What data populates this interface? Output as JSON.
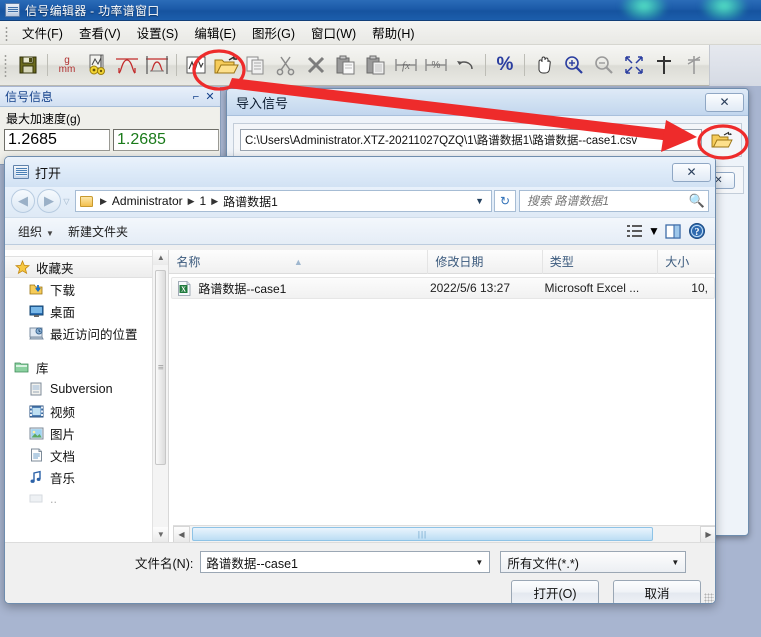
{
  "app": {
    "title": "信号编辑器 - 功率谱窗口",
    "title_icon": "app-icon",
    "menu": [
      {
        "label": "文件(F)"
      },
      {
        "label": "查看(V)"
      },
      {
        "label": "设置(S)"
      },
      {
        "label": "编辑(E)"
      },
      {
        "label": "图形(G)"
      },
      {
        "label": "窗口(W)"
      },
      {
        "label": "帮助(H)"
      }
    ],
    "toolbar": [
      {
        "name": "save-icon",
        "type": "icon"
      },
      {
        "name": "separator",
        "type": "sep"
      },
      {
        "name": "units-g-mm-icon",
        "type": "icon",
        "text_top": "g",
        "text_bottom": "mm"
      },
      {
        "name": "settings-gear-icon",
        "type": "icon"
      },
      {
        "name": "spectrum-curve-icon",
        "type": "icon"
      },
      {
        "name": "spectrum-grid-icon",
        "type": "icon"
      },
      {
        "name": "separator",
        "type": "sep"
      },
      {
        "name": "waveform-icon",
        "type": "icon"
      },
      {
        "name": "open-folder-icon",
        "type": "icon"
      },
      {
        "name": "copy-icon",
        "type": "icon"
      },
      {
        "name": "cut-scissors-icon",
        "type": "icon"
      },
      {
        "name": "delete-x-icon",
        "type": "icon"
      },
      {
        "name": "paste-icon",
        "type": "icon"
      },
      {
        "name": "paste-special-icon",
        "type": "icon"
      },
      {
        "name": "insert-fx-icon",
        "type": "icon"
      },
      {
        "name": "insert-percent-icon",
        "type": "icon"
      },
      {
        "name": "undo-icon",
        "type": "icon"
      },
      {
        "name": "separator",
        "type": "sep"
      },
      {
        "name": "percent-icon",
        "type": "icon"
      },
      {
        "name": "separator",
        "type": "sep"
      },
      {
        "name": "pan-hand-icon",
        "type": "icon"
      },
      {
        "name": "zoom-in-icon",
        "type": "icon"
      },
      {
        "name": "zoom-out-icon",
        "type": "icon"
      },
      {
        "name": "fit-to-window-icon",
        "type": "icon"
      },
      {
        "name": "crosshair-icon",
        "type": "icon"
      },
      {
        "name": "marker-icon",
        "type": "icon"
      }
    ]
  },
  "signal_info": {
    "title": "信号信息",
    "pin_icon": "pin-icon",
    "close_icon": "close-icon",
    "field_label": "最大加速度(g)",
    "value_left": "1.2685",
    "value_right": "1.2685",
    "value_right_color": "#1a7a1a"
  },
  "import_dialog": {
    "title": "导入信号",
    "close_label": "✕",
    "path_value": "C:\\Users\\Administrator.XTZ-20211027QZQ\\1\\路谱数据1\\路谱数据--case1.csv",
    "browse_icon": "open-folder-icon"
  },
  "open_dialog": {
    "title": "打开",
    "title_icon": "app-icon",
    "close_label": "✕",
    "nav": {
      "back_icon": "back-arrow-icon",
      "forward_icon": "forward-arrow-icon",
      "history_icon": "chevron-down-icon",
      "breadcrumb": [
        "Administrator",
        "1",
        "路谱数据1"
      ],
      "breadcrumb_caret": "▼",
      "refresh_icon": "refresh-icon"
    },
    "search": {
      "placeholder": "搜索 路谱数据1",
      "icon": "search-icon"
    },
    "command_bar": {
      "organize": "组织",
      "organize_caret": "▼",
      "new_folder": "新建文件夹",
      "view_icon": "view-list-icon",
      "view_caret": "▼",
      "preview_icon": "preview-pane-icon",
      "help_icon": "help-icon"
    },
    "sidebar": [
      {
        "label": "收藏夹",
        "icon": "star-icon",
        "root": true,
        "selected": true
      },
      {
        "label": "下载",
        "icon": "downloads-icon"
      },
      {
        "label": "桌面",
        "icon": "desktop-icon"
      },
      {
        "label": "最近访问的位置",
        "icon": "recent-places-icon"
      },
      {
        "gap": true
      },
      {
        "label": "库",
        "icon": "library-folder-icon",
        "root": true
      },
      {
        "label": "Subversion",
        "icon": "subversion-icon"
      },
      {
        "label": "视频",
        "icon": "video-icon"
      },
      {
        "label": "图片",
        "icon": "pictures-icon"
      },
      {
        "label": "文档",
        "icon": "documents-icon"
      },
      {
        "label": "音乐",
        "icon": "music-icon"
      }
    ],
    "columns": [
      {
        "label": "名称",
        "sorted": true
      },
      {
        "label": "修改日期"
      },
      {
        "label": "类型"
      },
      {
        "label": "大小"
      }
    ],
    "files": [
      {
        "name": "路谱数据--case1",
        "icon": "excel-file-icon",
        "date": "2022/5/6 13:27",
        "type": "Microsoft Excel ...",
        "size": "10,"
      }
    ],
    "footer": {
      "filename_label": "文件名(N):",
      "filename_value": "路谱数据--case1",
      "filter_value": "所有文件(*.*)",
      "open_button": "打开(O)",
      "cancel_button": "取消"
    }
  },
  "annotations": {
    "accent_color": "#ee2b2b",
    "circle_source": "open-folder-toolbar-button",
    "circle_target": "import-dialog-browse-button",
    "arrow": "red-arrow"
  }
}
